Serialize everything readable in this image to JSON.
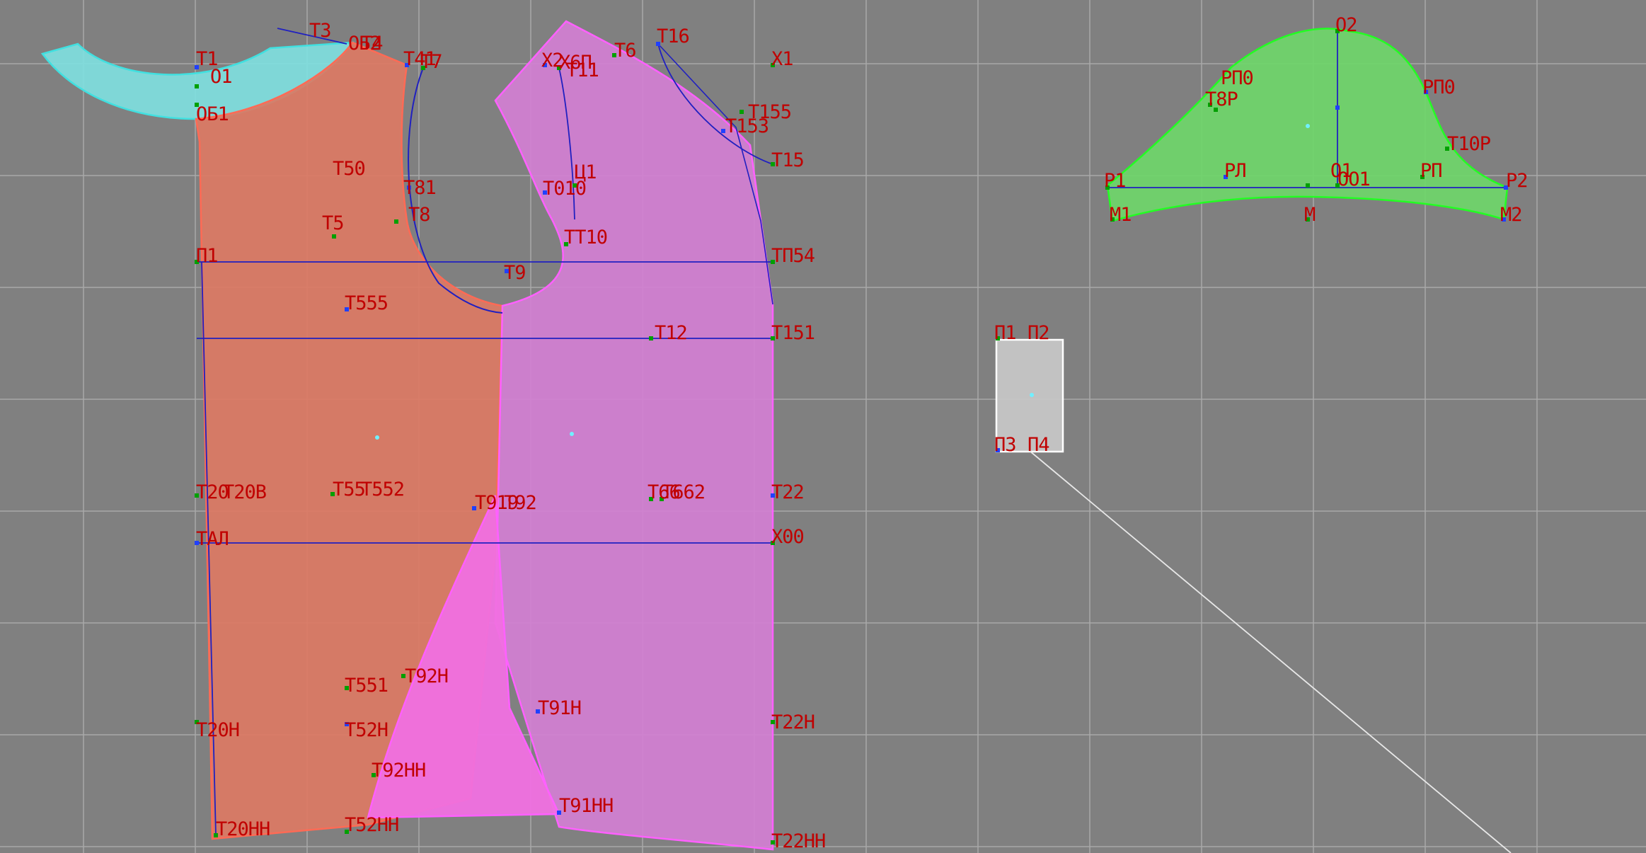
{
  "colors": {
    "background": "#808080",
    "grid": "#a8a8a8",
    "label": "#c00000",
    "construction_line": "#2020c0",
    "point_green": "#00a000",
    "point_blue": "#2040ff",
    "collar_fill": "#7fdede",
    "collar_stroke": "#40e0e0",
    "back_fill": "#dc7a64",
    "back_stroke": "#ff6a55",
    "front_fill": "#d37fd3",
    "front_stroke": "#ff60ff",
    "wedge_fill": "#f070e0",
    "sleeve_fill": "#6fd66a",
    "sleeve_stroke": "#22ff22",
    "tab_fill": "#c8c8c8",
    "connector_line": "#e8e8e8"
  },
  "pieces": [
    {
      "name": "collar-piece",
      "kind": "pattern-piece",
      "color": "collar"
    },
    {
      "name": "back-piece",
      "kind": "pattern-piece",
      "color": "back"
    },
    {
      "name": "front-piece",
      "kind": "pattern-piece",
      "color": "front"
    },
    {
      "name": "dart-wedge-piece",
      "kind": "pattern-piece",
      "color": "wedge"
    },
    {
      "name": "sleeve-piece",
      "kind": "pattern-piece",
      "color": "sleeve"
    },
    {
      "name": "small-tab-piece",
      "kind": "pattern-piece",
      "color": "tab"
    }
  ],
  "labels": {
    "T1": "Т1",
    "O1": "О1",
    "OB1": "ОБ1",
    "T3": "Т3",
    "OB2": "ОБ2",
    "T4": "Т4",
    "T41": "Т41",
    "T7": "Т7",
    "T50": "Т50",
    "T81": "Т81",
    "T8": "Т8",
    "T5": "Т5",
    "P1": "П1",
    "T555": "Т555",
    "T20": "Т20",
    "T20V": "Т20В",
    "T55": "Т55",
    "T552": "Т552",
    "TAL": "ТАЛ",
    "T551": "Т551",
    "T20H": "Т20Н",
    "T20HH": "Т20НН",
    "T52H": "Т52Н",
    "T52HH": "Т52НН",
    "X2": "Х2",
    "X6P": "Х6П",
    "T11": "Т11",
    "T6": "Т6",
    "T16": "Т16",
    "X1": "Х1",
    "T155": "Т155",
    "T153": "Т153",
    "T15": "Т15",
    "C1": "Ц1",
    "T010": "Т010",
    "TT10": "ТТ10",
    "T9": "Т9",
    "TP54": "ТП54",
    "T12": "Т12",
    "T151": "Т151",
    "T919": "Т919",
    "T92": "Т92",
    "T66": "Т66",
    "T662": "Т662",
    "T22": "Т22",
    "X00": "Х00",
    "T92H": "Т92Н",
    "T91H": "Т91Н",
    "T22H": "Т22Н",
    "T92HH": "Т92НН",
    "T91HH": "Т91НН",
    "T22HH": "Т22НН",
    "O2": "О2",
    "RP0a": "РП0",
    "RP0b": "РП0",
    "T8R": "Т8Р",
    "T10R": "Т10Р",
    "R1": "Р1",
    "RL": "РЛ",
    "O1s": "О1",
    "OO1": "ОО1",
    "RP": "РП",
    "R2": "Р2",
    "M1": "М1",
    "M": "М",
    "M2": "М2",
    "P1t": "П1",
    "P2t": "П2",
    "P3t": "П3",
    "P4t": "П4"
  }
}
